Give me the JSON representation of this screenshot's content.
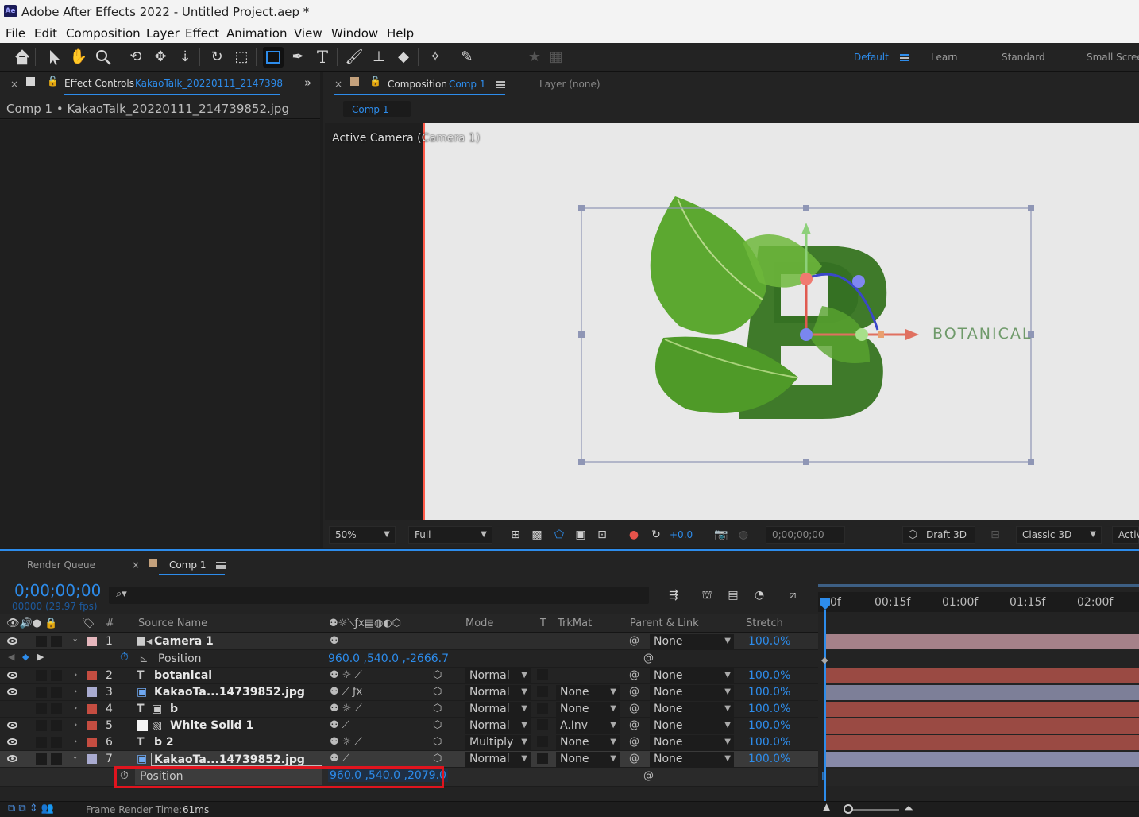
{
  "window": {
    "title": "Adobe After Effects 2022 - Untitled Project.aep *",
    "app_icon": "Ae"
  },
  "menu": [
    "File",
    "Edit",
    "Composition",
    "Layer",
    "Effect",
    "Animation",
    "View",
    "Window",
    "Help"
  ],
  "workspaces": {
    "default": "Default",
    "items": [
      "Learn",
      "Standard",
      "Small Scree"
    ]
  },
  "effect_controls": {
    "tab_label": "Effect Controls",
    "tab_target": "KakaoTalk_20220111_2147398",
    "subtitle": "Comp 1 • KakaoTalk_20220111_214739852.jpg",
    "overflow": "»"
  },
  "composition_panel": {
    "tab_label": "Composition",
    "tab_target": "Comp 1",
    "layer_tab": "Layer (none)",
    "sub_tab": "Comp 1",
    "camera_label": "Active Camera (Camera 1)",
    "canvas_text": "BOTANICAL",
    "zoom": "50%",
    "resolution": "Full",
    "exposure": "+0.0",
    "timecode": "0;00;00;00",
    "draft3d": "Draft 3D",
    "renderer": "Classic 3D",
    "view": "Activ"
  },
  "timeline": {
    "render_queue_tab": "Render Queue",
    "comp_tab": "Comp 1",
    "timecode": "0;00;00;00",
    "frame_info": "00000 (29.97 fps)",
    "search_placeholder": "",
    "ruler": [
      "0f",
      "00:15f",
      "01:00f",
      "01:15f",
      "02:00f"
    ],
    "headers": {
      "num": "#",
      "source": "Source Name",
      "mode": "Mode",
      "t": "T",
      "trkmat": "TrkMat",
      "parent": "Parent & Link",
      "stretch": "Stretch"
    },
    "camera_position": {
      "label": "Position",
      "value": "960.0 ,540.0 ,-2666.7"
    },
    "selected_position": {
      "label": "Position",
      "value": "960.0 ,540.0 ,2079.0"
    },
    "frame_render_label": "Frame Render Time:",
    "frame_render_value": "61ms",
    "layers": [
      {
        "num": "1",
        "name": "Camera 1",
        "type_icon": "camera-icon",
        "color": "#e6b7bd",
        "mode": "",
        "trkmat": "",
        "parent": "None",
        "stretch": "100.0%",
        "bar_color": "#a58189"
      },
      {
        "num": "2",
        "name": "botanical",
        "type_icon": "T",
        "color": "#c54d41",
        "mode": "Normal",
        "trkmat": "",
        "parent": "None",
        "stretch": "100.0%",
        "bar_color": "#9a4a43"
      },
      {
        "num": "3",
        "name": "KakaoTa...14739852.jpg",
        "type_icon": "image-icon",
        "color": "#a9abd0",
        "mode": "Normal",
        "trkmat": "None",
        "parent": "None",
        "stretch": "100.0%",
        "bar_color": "#7d7f98"
      },
      {
        "num": "4",
        "name": "b",
        "type_icon": "T",
        "color": "#c54d41",
        "mode": "Normal",
        "trkmat": "None",
        "parent": "None",
        "stretch": "100.0%",
        "bar_color": "#9a4a43"
      },
      {
        "num": "5",
        "name": "White Solid 1",
        "type_icon": "solid-icon",
        "color": "#c54d41",
        "mode": "Normal",
        "trkmat": "A.Inv",
        "parent": "None",
        "stretch": "100.0%",
        "bar_color": "#9a4a43"
      },
      {
        "num": "6",
        "name": "b 2",
        "type_icon": "T",
        "color": "#c54d41",
        "mode": "Multiply",
        "trkmat": "None",
        "parent": "None",
        "stretch": "100.0%",
        "bar_color": "#9a4a43"
      },
      {
        "num": "7",
        "name": "KakaoTa...14739852.jpg",
        "type_icon": "image-icon",
        "color": "#a9abd0",
        "mode": "Normal",
        "trkmat": "None",
        "parent": "None",
        "stretch": "100.0%",
        "bar_color": "#8789a8"
      }
    ]
  },
  "colors": {
    "accent": "#2d8ceb",
    "highlight_box": "#e0141e"
  }
}
